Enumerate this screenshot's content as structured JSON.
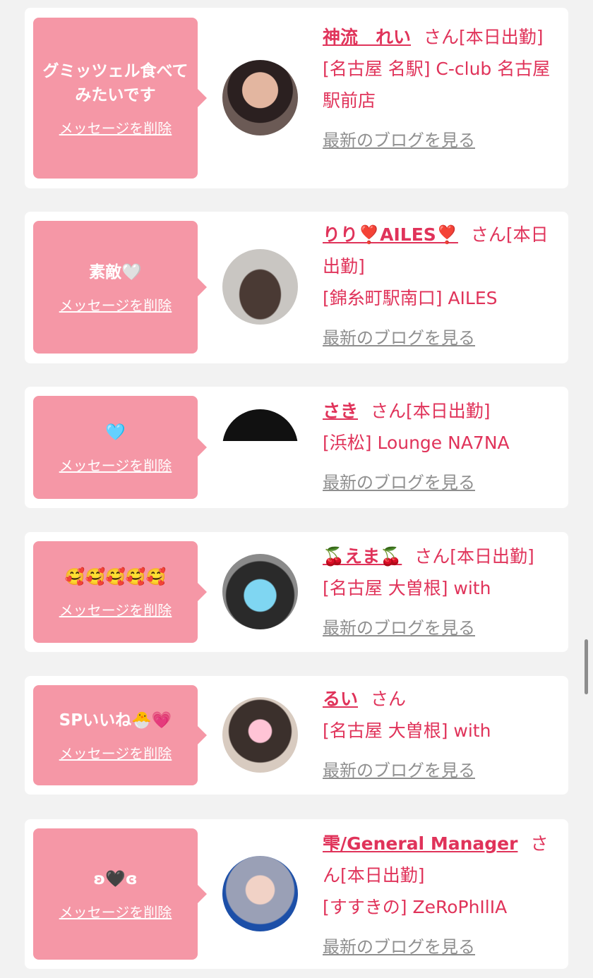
{
  "favorites": [
    {
      "message": "グミッツェル食べてみたいです",
      "delete_label": "メッセージを削除",
      "name": "神流　れい",
      "suffix": "さん[本日出勤]",
      "location": "[名古屋 名駅] C-club 名古屋駅前店",
      "blog_label": "最新のブログを見る"
    },
    {
      "message": "素敵🤍",
      "delete_label": "メッセージを削除",
      "name": "りり❣️AILES❣️",
      "suffix": "さん[本日出勤]",
      "location": "[錦糸町駅南口] AILES",
      "blog_label": "最新のブログを見る"
    },
    {
      "message": "🩵",
      "delete_label": "メッセージを削除",
      "name": "さき",
      "suffix": "さん[本日出勤]",
      "location": "[浜松] Lounge NA7NA",
      "blog_label": "最新のブログを見る"
    },
    {
      "message": "🥰🥰🥰🥰🥰",
      "delete_label": "メッセージを削除",
      "name": "🍒えま🍒",
      "suffix": "さん[本日出勤]",
      "location": "[名古屋 大曽根] with",
      "blog_label": "最新のブログを見る"
    },
    {
      "message": "SPいいね🐣💗",
      "delete_label": "メッセージを削除",
      "name": "るい",
      "suffix": "さん",
      "location": "[名古屋 大曽根] with",
      "blog_label": "最新のブログを見る"
    },
    {
      "message": "ʚ🖤ɞ",
      "delete_label": "メッセージを削除",
      "name": "雫/General Manager",
      "suffix": "さん[本日出勤]",
      "location": "[すすきの] ZeRoPhIlIA",
      "blog_label": "最新のブログを見る"
    }
  ],
  "colors": {
    "accent": "#e0335a",
    "bubble": "#f597a6",
    "card": "#ffffff",
    "background": "#f2f2f2",
    "link_gray": "#8f8f8f"
  }
}
